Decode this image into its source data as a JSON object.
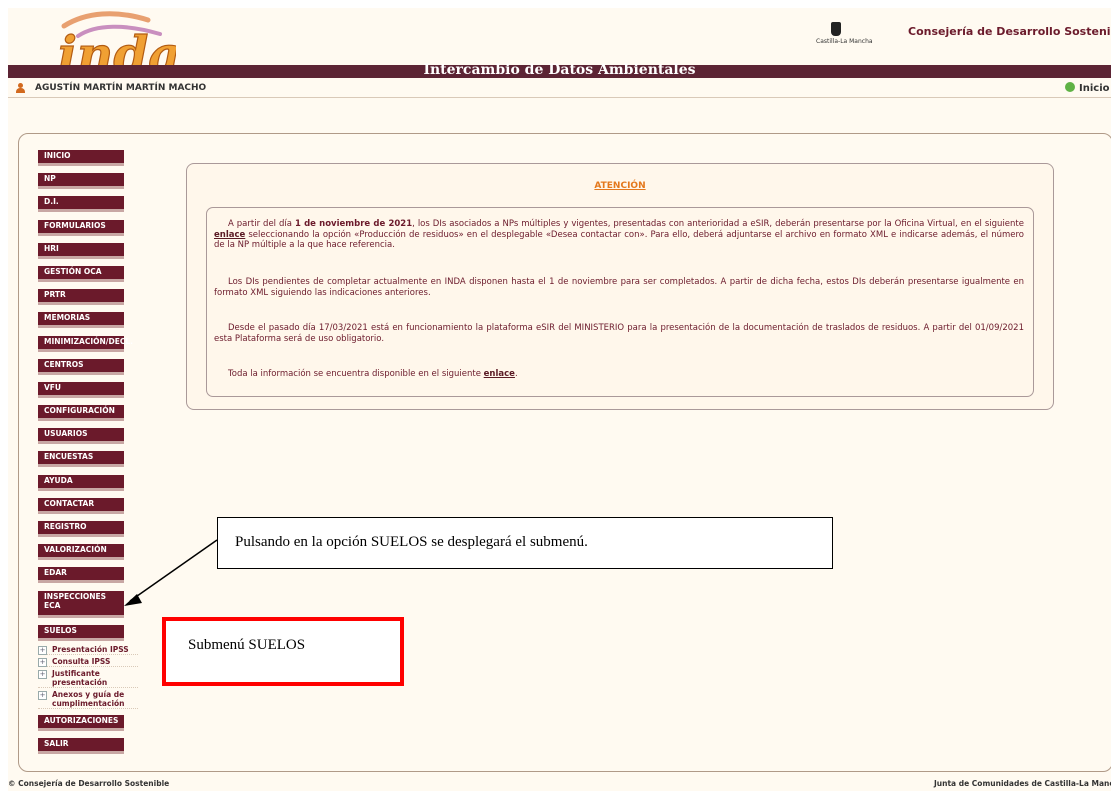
{
  "header": {
    "logo_text": "inda",
    "crest_text": "Castilla-La Mancha",
    "consejeria": "Consejería de Desarrollo Sostenible",
    "app_title": "Intercambio de Datos Ambientales"
  },
  "userbar": {
    "username": "AGUSTÍN MARTÍN MARTÍN MACHO",
    "inicio": "Inicio"
  },
  "sidebar": {
    "items": [
      {
        "label": "INICIO"
      },
      {
        "label": "NP"
      },
      {
        "label": "D.I."
      },
      {
        "label": "FORMULARIOS"
      },
      {
        "label": "HRI"
      },
      {
        "label": "GESTIÓN OCA"
      },
      {
        "label": "PRTR"
      },
      {
        "label": "MEMORIAS"
      },
      {
        "label": "MINIMIZACIÓN/DECL."
      },
      {
        "label": "CENTROS"
      },
      {
        "label": "VFU"
      },
      {
        "label": "CONFIGURACIÓN"
      },
      {
        "label": "USUARIOS"
      },
      {
        "label": "ENCUESTAS"
      },
      {
        "label": "AYUDA"
      },
      {
        "label": "CONTACTAR"
      },
      {
        "label": "REGISTRO"
      },
      {
        "label": "VALORIZACIÓN"
      },
      {
        "label": "EDAR"
      },
      {
        "label": "INSPECCIONES ECA"
      },
      {
        "label": "SUELOS"
      },
      {
        "label": "AUTORIZACIONES"
      },
      {
        "label": "SALIR"
      }
    ],
    "submenu": [
      {
        "label": "Presentación IPSS"
      },
      {
        "label": "Consulta IPSS"
      },
      {
        "label": "Justificante presentación"
      },
      {
        "label": "Anexos y guía de cumplimentación"
      }
    ]
  },
  "notice": {
    "title": "ATENCIÓN",
    "p1_a": "A partir del día ",
    "p1_date": "1 de noviembre de 2021",
    "p1_b": ", los DIs asociados a NPs múltiples y vigentes, presentadas con anterioridad a eSIR, deberán presentarse por la Oficina Virtual, en el siguiente ",
    "p1_link": "enlace",
    "p1_c": " seleccionando la opción «Producción de residuos» en el desplegable «Desea contactar con». Para ello, deberá adjuntarse el archivo en formato XML e indicarse además, el número de la NP múltiple a la que hace referencia.",
    "p2": "Los DIs pendientes de completar actualmente en INDA disponen hasta el 1 de noviembre para ser completados. A partir de dicha fecha, estos DIs deberán presentarse igualmente en formato XML siguiendo las indicaciones anteriores.",
    "p3": "Desde el pasado día 17/03/2021 está en funcionamiento la plataforma eSIR del MINISTERIO para la presentación de la documentación de traslados de residuos. A partir del 01/09/2021 esta Plataforma será de uso obligatorio.",
    "p4_a": "Toda la información se encuentra disponible en el siguiente ",
    "p4_link": "enlace",
    "p4_b": "."
  },
  "annotations": {
    "callout": "Pulsando en la opción SUELOS se desplegará el submenú.",
    "submenu_box": "Submenú SUELOS"
  },
  "footer": {
    "left": "© Consejería de Desarrollo Sostenible",
    "right": "Junta de Comunidades de Castilla-La Mancha"
  },
  "colors": {
    "brand": "#6b1a2b",
    "band": "#5c2434",
    "title_orange": "#e4781c",
    "highlight_red": "#ff0000"
  }
}
